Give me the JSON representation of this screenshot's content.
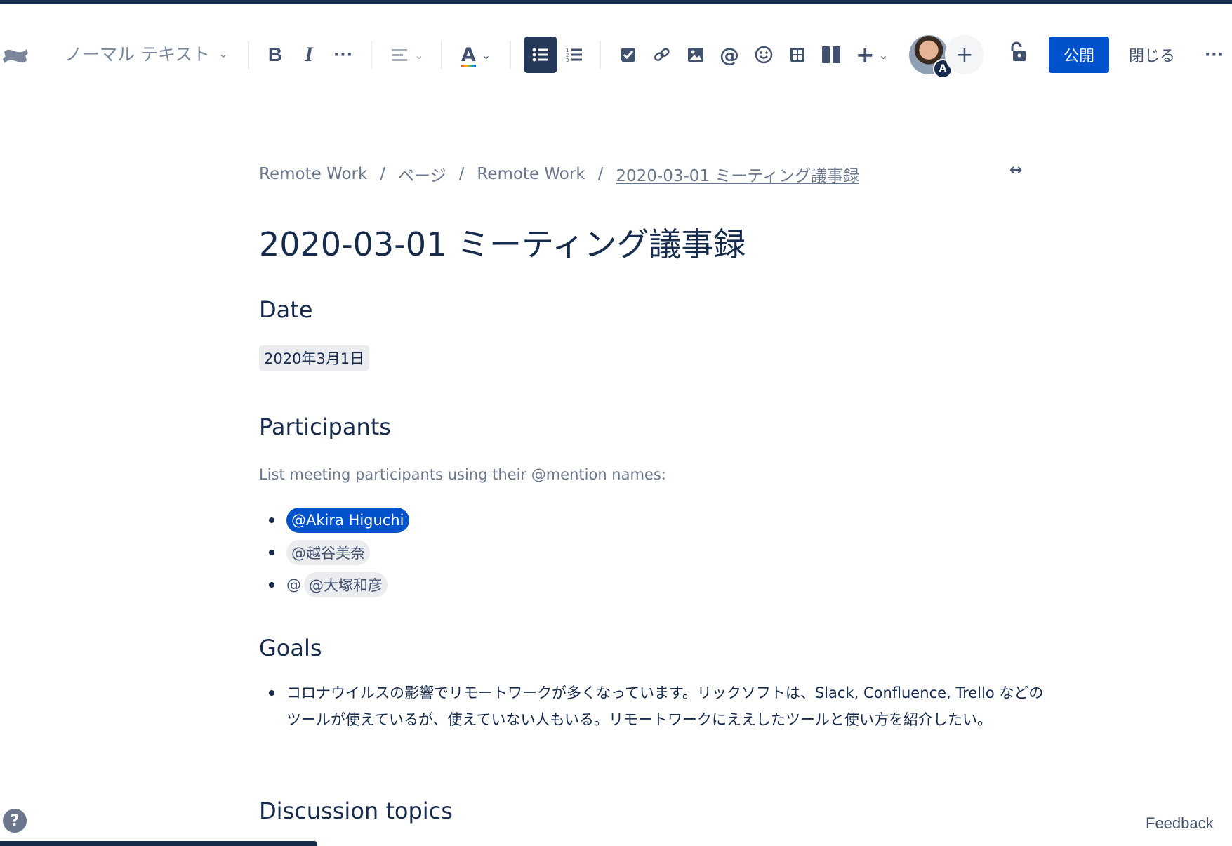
{
  "toolbar": {
    "text_style": "ノーマル テキスト",
    "bold_icon": "bold-icon",
    "publish_label": "公開",
    "close_label": "閉じる",
    "avatar_badge": "A",
    "more_label": "···"
  },
  "breadcrumb": {
    "items": [
      "Remote Work",
      "ページ",
      "Remote Work",
      "2020-03-01 ミーティング議事録"
    ],
    "separator": "/"
  },
  "page": {
    "title": "2020-03-01 ミーティング議事録",
    "date_heading": "Date",
    "date_value": "2020年3月1日",
    "participants_heading": "Participants",
    "participants_hint": "List meeting participants using their @mention names:",
    "participants": [
      {
        "mention": "@Akira Higuchi",
        "prefix": ""
      },
      {
        "mention": "@越谷美奈",
        "prefix": ""
      },
      {
        "mention": "@大塚和彦",
        "prefix": "@"
      }
    ],
    "goals_heading": "Goals",
    "goals_item": "コロナウイルスの影響でリモートワークが多くなっています。リックソフトは、Slack, Confluence, Trello などのツールが使えているが、使えていない人もいる。リモートワークにええしたツールと使い方を紹介したい。",
    "discussion_heading": "Discussion topics"
  },
  "footer": {
    "help": "?",
    "feedback": "Feedback"
  },
  "colors": {
    "primary": "#0052cc",
    "text": "#172b4d",
    "subtle": "#6b778c",
    "chip_bg": "#ebecf0"
  }
}
